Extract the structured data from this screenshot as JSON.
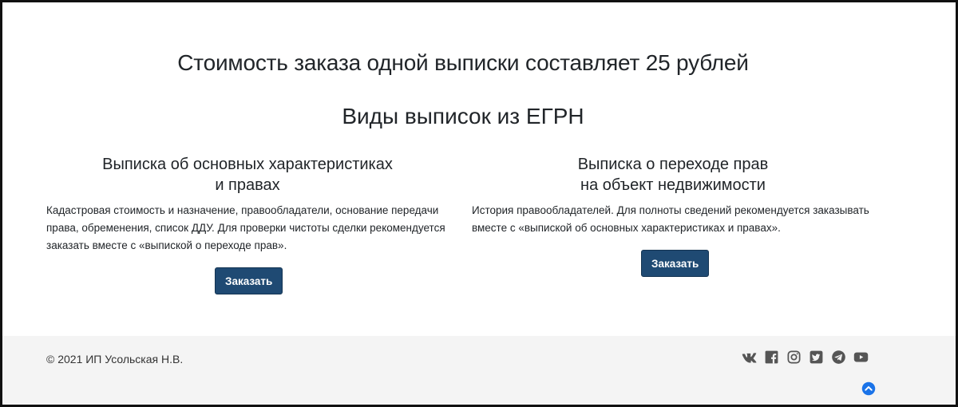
{
  "main": {
    "price_text": "Стоимость заказа одной выписки составляет 25 рублей",
    "section_title": "Виды выписок из ЕГРН"
  },
  "cards": [
    {
      "title_line1": "Выписка об основных характеристиках",
      "title_line2": "и правах",
      "description": "Кадастровая стоимость и назначение, правообладатели, основание передачи права, обременения, список ДДУ. Для проверки чистоты сделки рекомендуется заказать вместе с «выпиской о переходе прав».",
      "button_label": "Заказать"
    },
    {
      "title_line1": "Выписка о переходе прав",
      "title_line2": "на объект недвижимости",
      "description": "История правообладателей. Для полноты сведений рекомендуется заказывать вместе с «выпиской об основных характеристиках и правах».",
      "button_label": "Заказать"
    }
  ],
  "footer": {
    "copyright": "© 2021 ИП Усольская Н.В.",
    "social_icons": [
      "vk-icon",
      "facebook-icon",
      "instagram-icon",
      "twitter-icon",
      "telegram-icon",
      "youtube-icon"
    ],
    "scroll_top_icon": "chevron-up-circle-icon"
  },
  "colors": {
    "button_bg": "#1f4a73",
    "footer_bg": "#f4f4f4",
    "icon_color": "#555555",
    "scroll_top_color": "#1a73e8"
  }
}
